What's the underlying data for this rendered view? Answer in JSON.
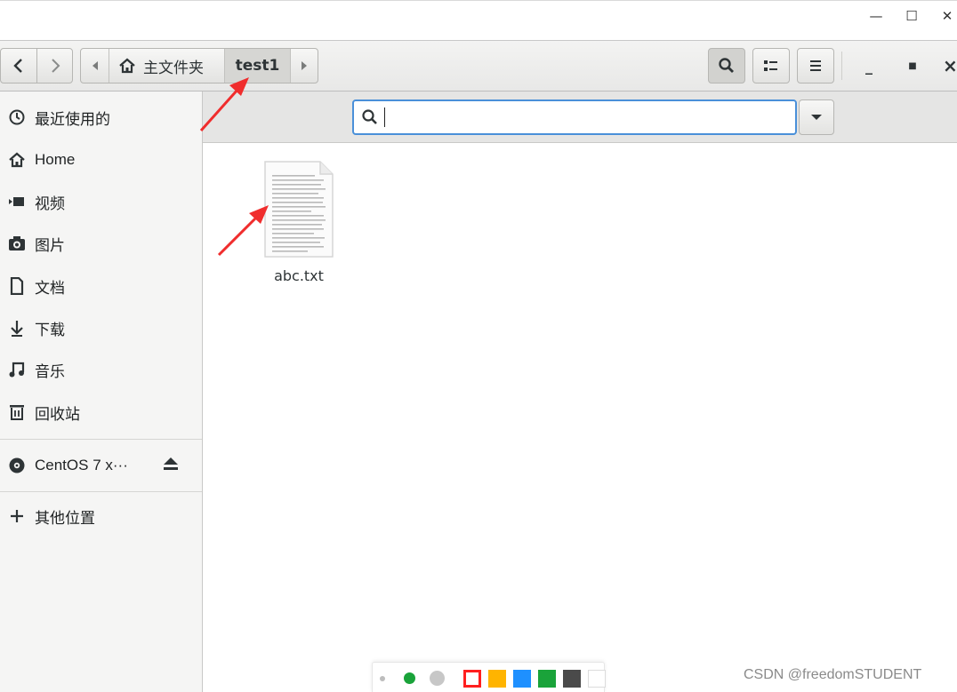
{
  "window": {
    "controls": {
      "minimize": "—",
      "maximize": "☐",
      "close": "✕"
    },
    "headerbar_controls": {
      "minimize": "_",
      "maximize": "■",
      "close": "×"
    }
  },
  "pathbar": {
    "home_label": "主文件夹",
    "current_label": "test1"
  },
  "sidebar": {
    "items": [
      {
        "label": "最近使用的",
        "icon": "recent-clock-icon"
      },
      {
        "label": "Home",
        "icon": "home-icon"
      },
      {
        "label": "视频",
        "icon": "video-camera-icon"
      },
      {
        "label": "图片",
        "icon": "camera-icon"
      },
      {
        "label": "文档",
        "icon": "document-icon"
      },
      {
        "label": "下载",
        "icon": "download-arrow-icon"
      },
      {
        "label": "音乐",
        "icon": "music-note-icon"
      },
      {
        "label": "回收站",
        "icon": "trash-icon"
      }
    ],
    "device": {
      "label": "CentOS 7 x···",
      "icon": "disc-icon",
      "action_icon": "eject-icon"
    },
    "other": {
      "label": "其他位置",
      "icon": "plus-icon"
    }
  },
  "search": {
    "value": "",
    "icon": "search-icon"
  },
  "files": [
    {
      "name": "abc.txt",
      "icon": "text-file-icon"
    }
  ],
  "annotation_palette": {
    "colors": [
      "#bdbdbd",
      "#1aa33a",
      "#c7c7c7",
      "#ff1f1f",
      "#ffb400",
      "#1e90ff",
      "#1aa33a",
      "#4a4a4a",
      "#ffffff"
    ]
  },
  "watermark": "CSDN @freedomSTUDENT",
  "colors": {
    "accent": "#4a90d9",
    "annotation_arrow": "#f02d2d"
  }
}
